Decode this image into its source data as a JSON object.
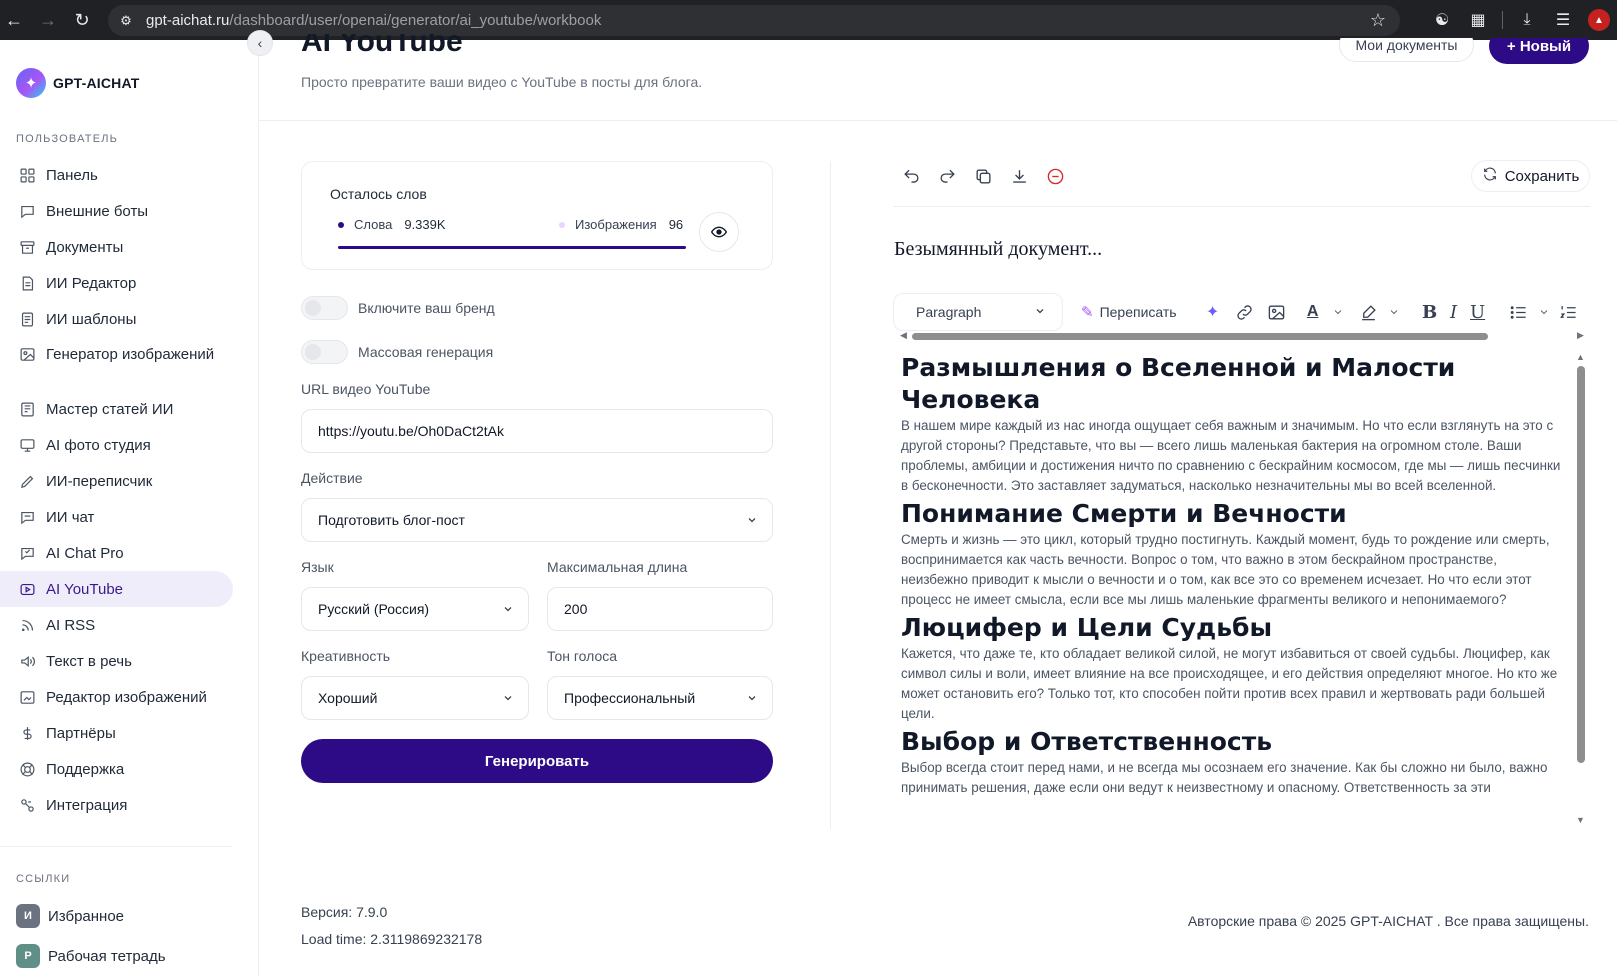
{
  "browser": {
    "url_host": "gpt-aichat.ru",
    "url_path": "/dashboard/user/openai/generator/ai_youtube/workbook"
  },
  "brand": {
    "name": "GPT-AICHAT"
  },
  "sidebar": {
    "section_user": "ПОЛЬЗОВАТЕЛЬ",
    "items": [
      {
        "label": "Панель",
        "icon": "grid-icon"
      },
      {
        "label": "Внешние боты",
        "icon": "chat-bubble-icon"
      },
      {
        "label": "Документы",
        "icon": "archive-icon"
      },
      {
        "label": "ИИ Редактор",
        "icon": "document-icon"
      },
      {
        "label": "ИИ шаблоны",
        "icon": "list-document-icon"
      },
      {
        "label": "Генератор изображений",
        "icon": "image-icon"
      },
      {
        "label": "Мастер статей ИИ",
        "icon": "article-icon"
      },
      {
        "label": "AI фото студия",
        "icon": "monitor-icon"
      },
      {
        "label": "ИИ-переписчик",
        "icon": "pen-icon"
      },
      {
        "label": "ИИ чат",
        "icon": "message-icon"
      },
      {
        "label": "AI Chat Pro",
        "icon": "chat-pro-icon"
      },
      {
        "label": "AI YouTube",
        "icon": "youtube-icon"
      },
      {
        "label": "AI RSS",
        "icon": "rss-icon"
      },
      {
        "label": "Текст в речь",
        "icon": "speaker-icon"
      },
      {
        "label": "Редактор изображений",
        "icon": "image-edit-icon"
      },
      {
        "label": "Партнёры",
        "icon": "dollar-icon"
      },
      {
        "label": "Поддержка",
        "icon": "lifebuoy-icon"
      },
      {
        "label": "Интеграция",
        "icon": "integration-icon"
      }
    ],
    "active_index": 11,
    "section_links": "ССЫЛКИ",
    "links": [
      {
        "badge": "И",
        "label": "Избранное",
        "color": "#6b7280"
      },
      {
        "badge": "Р",
        "label": "Рабочая тетрадь",
        "color": "#5f8f86"
      }
    ]
  },
  "header": {
    "title": "AI YouTube",
    "subtitle": "Просто превратите ваши видео с YouTube в посты для блога.",
    "my_docs_label": "Мои документы",
    "new_label": "+ Новый"
  },
  "usage": {
    "title": "Осталось слов",
    "words_label": "Слова",
    "words_value": "9.339K",
    "images_label": "Изображения",
    "images_value": "96"
  },
  "form": {
    "brand_toggle_label": "Включите ваш бренд",
    "bulk_toggle_label": "Массовая генерация",
    "url_label": "URL видео YouTube",
    "url_value": "https://youtu.be/Oh0DaCt2tAk",
    "action_label": "Действие",
    "action_value": "Подготовить блог-пост",
    "language_label": "Язык",
    "language_value": "Русский (Россия)",
    "max_length_label": "Максимальная длина",
    "max_length_value": "200",
    "creativity_label": "Креативность",
    "creativity_value": "Хороший",
    "tone_label": "Тон голоса",
    "tone_value": "Профессиональный",
    "generate_label": "Генерировать"
  },
  "editor": {
    "save_label": "Сохранить",
    "doc_title": "Безымянный документ...",
    "paragraph_label": "Paragraph",
    "rewrite_label": "Переписать",
    "sections": [
      {
        "heading": "Размышления о Вселенной и Малости Человека",
        "text": "В нашем мире каждый из нас иногда ощущает себя важным и значимым. Но что если взглянуть на это с другой стороны? Представьте, что вы — всего лишь маленькая бактерия на огромном столе. Ваши проблемы, амбиции и достижения ничто по сравнению с бескрайним космосом, где мы — лишь песчинки в бесконечности. Это заставляет задуматься, насколько незначительны мы во всей вселенной."
      },
      {
        "heading": "Понимание Смерти и Вечности",
        "text": "Смерть и жизнь — это цикл, который трудно постигнуть. Каждый момент, будь то рождение или смерть, воспринимается как часть вечности. Вопрос о том, что важно в этом бескрайном пространстве, неизбежно приводит к мысли о вечности и о том, как все это со временем исчезает. Но что если этот процесс не имеет смысла, если все мы лишь маленькие фрагменты великого и непонимаемого?"
      },
      {
        "heading": "Люцифер и Цели Судьбы",
        "text": "Кажется, что даже те, кто обладает великой силой, не могут избавиться от своей судьбы. Люцифер, как символ силы и воли, имеет влияние на все происходящее, и его действия определяют многое. Но кто же может остановить его? Только тот, кто способен пойти против всех правил и жертвовать ради большей цели."
      },
      {
        "heading": "Выбор и Ответственность",
        "text": "Выбор всегда стоит перед нами, и не всегда мы осознаем его значение. Как бы сложно ни было, важно принимать решения, даже если они ведут к неизвестному и опасному. Ответственность за эти"
      }
    ]
  },
  "footer": {
    "version": "Версия: 7.9.0",
    "load_time": "Load time: 2.3119869232178",
    "copyright": "Авторские права © 2025 GPT-AICHAT . Все права защищены."
  },
  "colors": {
    "primary": "#2e0b86",
    "active_bg": "#efedf9"
  }
}
